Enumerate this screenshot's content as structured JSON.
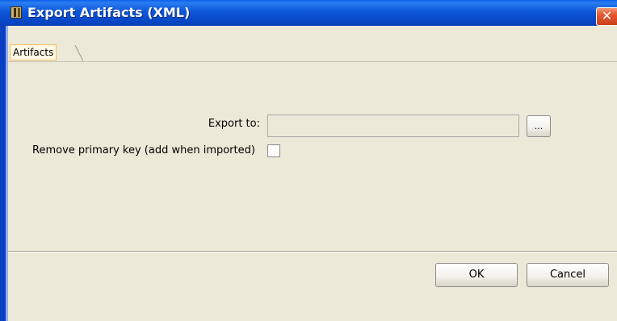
{
  "window": {
    "title": "Export Artifacts (XML)",
    "close_symbol": "✕",
    "title_icon": "app-icon"
  },
  "tabs": [
    {
      "label": "Artifacts",
      "selected": true
    }
  ],
  "form": {
    "export_label": "Export to:",
    "export_value": "",
    "browse_label": "...",
    "remove_pk_label": "Remove primary key (add when imported)",
    "remove_pk_checked": false
  },
  "buttons": {
    "ok_label": "OK",
    "cancel_label": "Cancel"
  },
  "colors": {
    "titlebar": "#0a5fe8",
    "dialog_bg": "#ece9d8",
    "tab_highlight": "#f4bd5c",
    "close_button": "#e45c33"
  }
}
